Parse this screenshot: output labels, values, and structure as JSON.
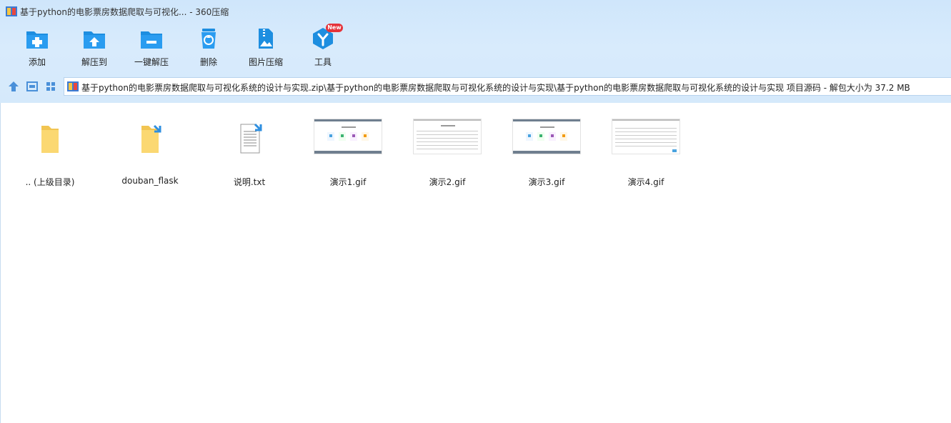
{
  "window": {
    "title": "基于python的电影票房数据爬取与可视化... - 360压缩"
  },
  "toolbar": {
    "buttons": [
      {
        "label": "添加",
        "icon": "add-icon"
      },
      {
        "label": "解压到",
        "icon": "extract-to-icon"
      },
      {
        "label": "一键解压",
        "icon": "one-click-extract-icon"
      },
      {
        "label": "删除",
        "icon": "delete-icon"
      },
      {
        "label": "图片压缩",
        "icon": "image-compress-icon"
      },
      {
        "label": "工具",
        "icon": "tools-icon"
      }
    ],
    "new_badge": "New"
  },
  "address_bar": {
    "path": "基于python的电影票房数据爬取与可视化系统的设计与实现.zip\\基于python的电影票房数据爬取与可视化系统的设计与实现\\基于python的电影票房数据爬取与可视化系统的设计与实现 项目源码 - 解包大小为 37.2 MB"
  },
  "files": [
    {
      "name": ".. (上级目录)",
      "type": "parent-folder"
    },
    {
      "name": "douban_flask",
      "type": "folder"
    },
    {
      "name": "说明.txt",
      "type": "text"
    },
    {
      "name": "演示1.gif",
      "type": "gif"
    },
    {
      "name": "演示2.gif",
      "type": "gif"
    },
    {
      "name": "演示3.gif",
      "type": "gif"
    },
    {
      "name": "演示4.gif",
      "type": "gif"
    }
  ],
  "colors": {
    "accent": "#1d8ee0",
    "header_bg": "#d5e9fb",
    "badge": "#e5333a"
  }
}
